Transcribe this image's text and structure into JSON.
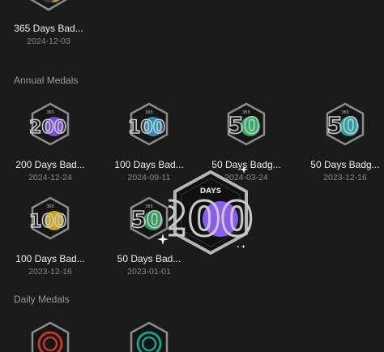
{
  "sections": {
    "annual": "Annual Medals",
    "daily": "Daily Medals"
  },
  "top_badge": {
    "label": "365 Days Bad...",
    "date": "2024-12-03"
  },
  "annual_badges": [
    {
      "label": "200 Days Bad...",
      "date": "2024-12-24",
      "icon": "200-days-badge-icon",
      "color": "#7b4dd9"
    },
    {
      "label": "100 Days Bad...",
      "date": "2024-09-11",
      "icon": "100-days-badge-icon",
      "color": "#2e8fb3"
    },
    {
      "label": "50 Days Badg...",
      "date": "2024-03-24",
      "icon": "50-days-badge-icon",
      "color": "#2fae6a"
    },
    {
      "label": "50 Days Badg...",
      "date": "2023-12-16",
      "icon": "50-days-badge-icon",
      "color": "#2aa3a0"
    },
    {
      "label": "100 Days Bad...",
      "date": "2023-12-16",
      "icon": "100-days-badge-icon",
      "color": "#c9a516"
    },
    {
      "label": "50 Days Bad...",
      "date": "2023-01-01",
      "icon": "50-days-badge-icon",
      "color": "#2f9c5f"
    }
  ],
  "spotlight": {
    "label": "DAYS",
    "number": "200",
    "icon": "200-days-badge-spotlight-icon",
    "color": "#8a5cf0"
  },
  "badge_small_text": "365",
  "daily_badges": [
    {
      "icon": "daily-medal-red-icon",
      "color": "#c0392b"
    },
    {
      "icon": "daily-medal-teal-icon",
      "color": "#1f9c8c"
    }
  ]
}
